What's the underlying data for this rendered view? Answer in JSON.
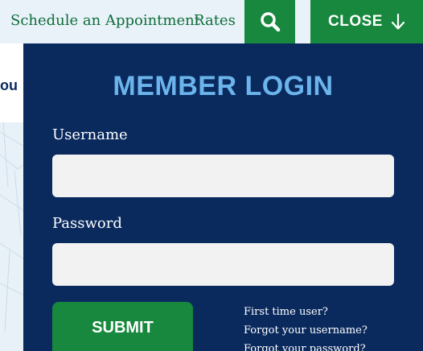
{
  "nav": {
    "schedule_label": "Schedule an Appointment",
    "rates_label": "Rates",
    "search_icon": "search-icon",
    "close_label": "CLOSE",
    "close_icon": "arrow-down-icon"
  },
  "background": {
    "heading_fragment": "ou"
  },
  "login": {
    "title": "MEMBER LOGIN",
    "username_label": "Username",
    "username_value": "",
    "password_label": "Password",
    "password_value": "",
    "submit_label": "SUBMIT",
    "links": {
      "first_time": "First time user?",
      "forgot_username": "Forgot your username?",
      "forgot_password": "Forgot your password?"
    }
  },
  "colors": {
    "nav_link": "#0f6d3a",
    "green_button": "#17883d",
    "panel_bg": "#0a2a5e",
    "title": "#6bb4ec",
    "topbar_bg": "#e9f2f9"
  }
}
